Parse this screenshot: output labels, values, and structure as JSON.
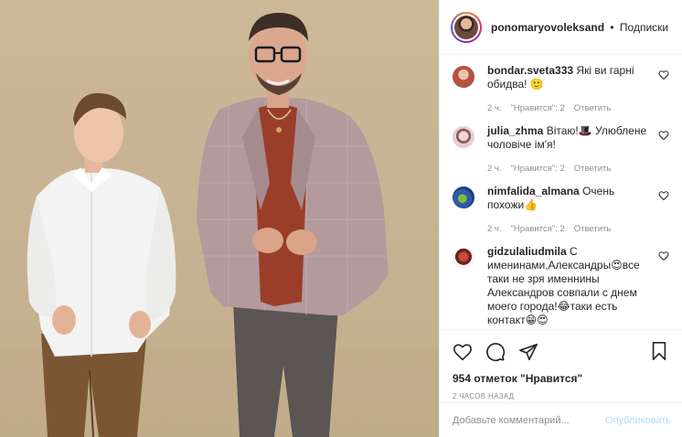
{
  "header": {
    "username": "ponomaryovoleksand",
    "separator": "•",
    "follow_status": "Подписки"
  },
  "comments": [
    {
      "user": "bondar.sveta333",
      "text": "Які ви гарні обидва! 🙂",
      "time": "2 ч.",
      "likes": "\"Нравится\": 2",
      "reply": "Ответить",
      "avatar_color": "#c46a5a"
    },
    {
      "user": "julia_zhma",
      "text": "Вітаю!🎩 Улюблене чоловіче ім'я!",
      "time": "2 ч.",
      "likes": "\"Нравится\": 2",
      "reply": "Ответить",
      "avatar_color": "#d9b7bd"
    },
    {
      "user": "nimfalida_almana",
      "text": "Очень похожи👍",
      "time": "2 ч.",
      "likes": "\"Нравится\": 2",
      "reply": "Ответить",
      "avatar_color": "#3e5fa8"
    },
    {
      "user": "gidzulaliudmila",
      "text": "С именинами,Александры😍все таки не зря именнины Александров совпали с днем моего города!😂таки есть контакт😁😍",
      "time": "",
      "likes": "",
      "reply": "",
      "avatar_color": "#a8352e"
    }
  ],
  "actions": {
    "like_icon": "heart-outline-icon",
    "comment_icon": "speech-bubble-icon",
    "share_icon": "paper-plane-icon",
    "save_icon": "bookmark-icon"
  },
  "likes_text": "954 отметок \"Нравится\"",
  "time_ago": "2 ЧАСОВ НАЗАД",
  "add_comment": {
    "placeholder": "Добавьте комментарий...",
    "publish_label": "Опубликовать"
  },
  "colors": {
    "background": "#c9b594",
    "link_disabled": "#b3dbff",
    "muted": "#8e8e8e",
    "text": "#262626"
  }
}
